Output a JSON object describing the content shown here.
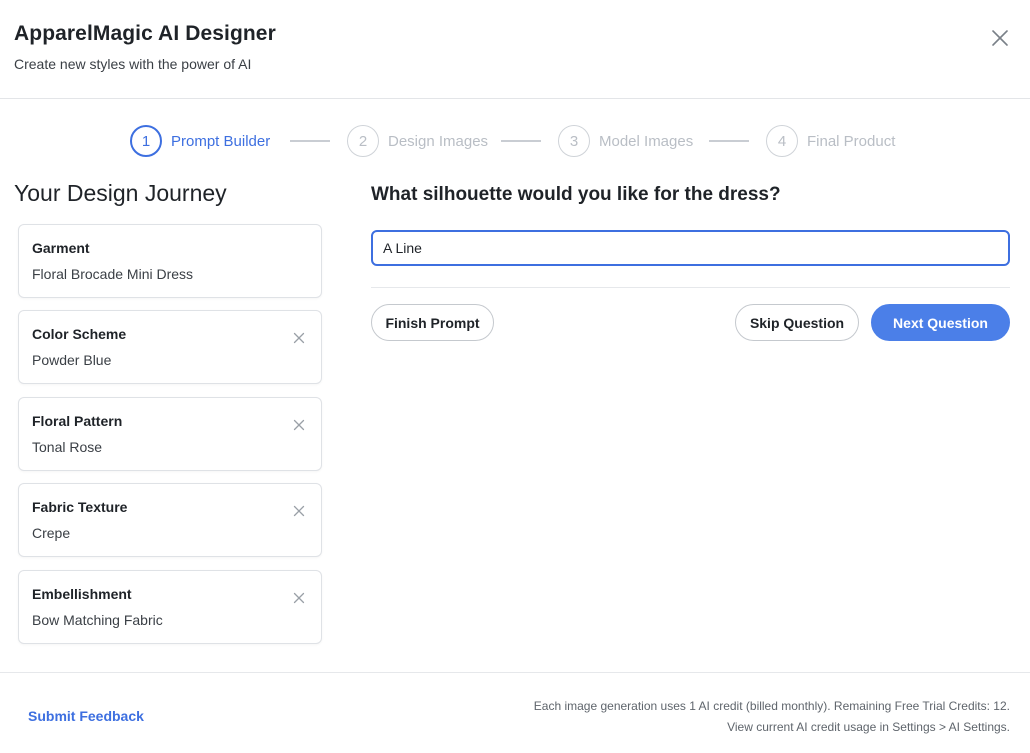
{
  "header": {
    "title": "ApparelMagic AI Designer",
    "subtitle": "Create new styles with the power of AI",
    "close_icon": "close-icon"
  },
  "stepper": {
    "active_step": 1,
    "steps": [
      {
        "number": "1",
        "label": "Prompt Builder"
      },
      {
        "number": "2",
        "label": "Design Images"
      },
      {
        "number": "3",
        "label": "Model Images"
      },
      {
        "number": "4",
        "label": "Final Product"
      }
    ]
  },
  "journey": {
    "title": "Your Design Journey",
    "cards": [
      {
        "title": "Garment",
        "value": "Floral Brocade Mini Dress",
        "removable": false
      },
      {
        "title": "Color Scheme",
        "value": "Powder Blue",
        "removable": true
      },
      {
        "title": "Floral Pattern",
        "value": "Tonal Rose",
        "removable": true
      },
      {
        "title": "Fabric Texture",
        "value": "Crepe",
        "removable": true
      },
      {
        "title": "Embellishment",
        "value": "Bow Matching Fabric",
        "removable": true
      }
    ]
  },
  "prompt": {
    "question": "What silhouette would you like for the dress?",
    "answer_value": "A Line",
    "finish_label": "Finish Prompt",
    "skip_label": "Skip Question",
    "next_label": "Next Question"
  },
  "footer": {
    "feedback_label": "Submit Feedback",
    "credit_line_1": "Each image generation uses 1 AI credit (billed monthly). Remaining Free Trial Credits: 12.",
    "credit_line_2": "View current AI credit usage in Settings > AI Settings."
  },
  "colors": {
    "accent": "#3d6fe0",
    "primary_button": "#4b7fe8",
    "inactive": "#b9bec5",
    "border": "#dfe2e6"
  }
}
